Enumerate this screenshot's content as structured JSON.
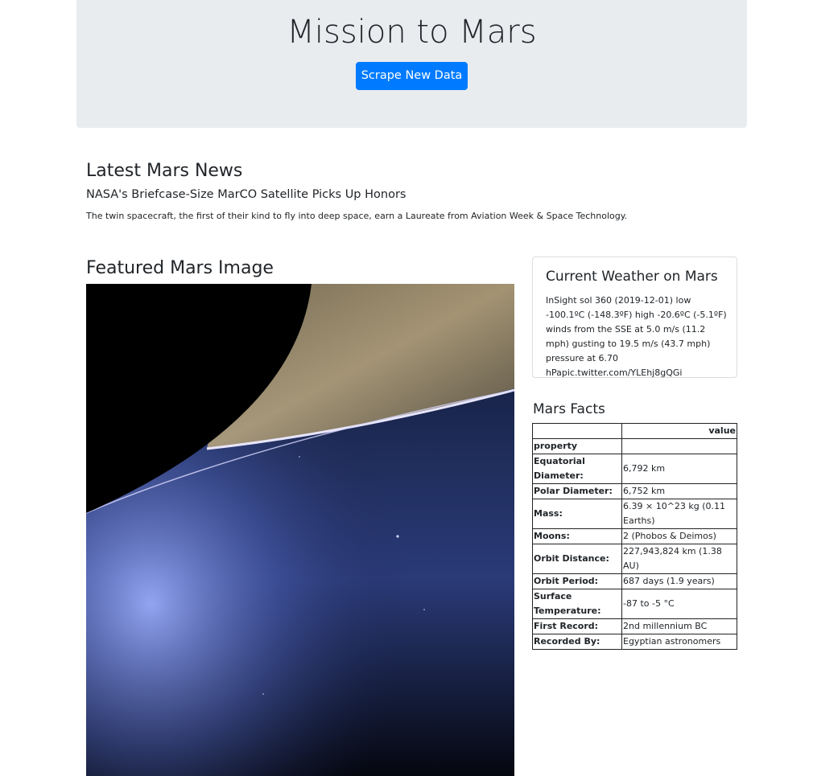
{
  "header": {
    "title": "Mission to Mars",
    "scrape_button": "Scrape New Data"
  },
  "news": {
    "section_title": "Latest Mars News",
    "headline": "NASA's Briefcase-Size MarCO Satellite Picks Up Honors",
    "paragraph": "The twin spacecraft, the first of their kind to fly into deep space, earn a Laureate from Aviation Week & Space Technology."
  },
  "featured": {
    "section_title": "Featured Mars Image"
  },
  "weather": {
    "title": "Current Weather on Mars",
    "text": "InSight sol 360 (2019-12-01) low -100.1ºC (-148.3ºF) high -20.6ºC (-5.1ºF) winds from the SSE at 5.0 m/s (11.2 mph) gusting to 19.5 m/s (43.7 mph) pressure at 6.70 hPapic.twitter.com/YLEhj8gQGi"
  },
  "facts": {
    "title": "Mars Facts",
    "header_value": "value",
    "header_property": "property",
    "rows": [
      {
        "property": "Equatorial Diameter:",
        "value": "6,792 km"
      },
      {
        "property": "Polar Diameter:",
        "value": "6,752 km"
      },
      {
        "property": "Mass:",
        "value": "6.39 × 10^23 kg (0.11 Earths)"
      },
      {
        "property": "Moons:",
        "value": "2 (Phobos & Deimos)"
      },
      {
        "property": "Orbit Distance:",
        "value": "227,943,824 km (1.38 AU)"
      },
      {
        "property": "Orbit Period:",
        "value": "687 days (1.9 years)"
      },
      {
        "property": "Surface Temperature:",
        "value": "-87 to -5 °C"
      },
      {
        "property": "First Record:",
        "value": "2nd millennium BC"
      },
      {
        "property": "Recorded By:",
        "value": "Egyptian astronomers"
      }
    ]
  },
  "colors": {
    "accent": "#007bff",
    "jumbotron": "#e9ecef"
  }
}
